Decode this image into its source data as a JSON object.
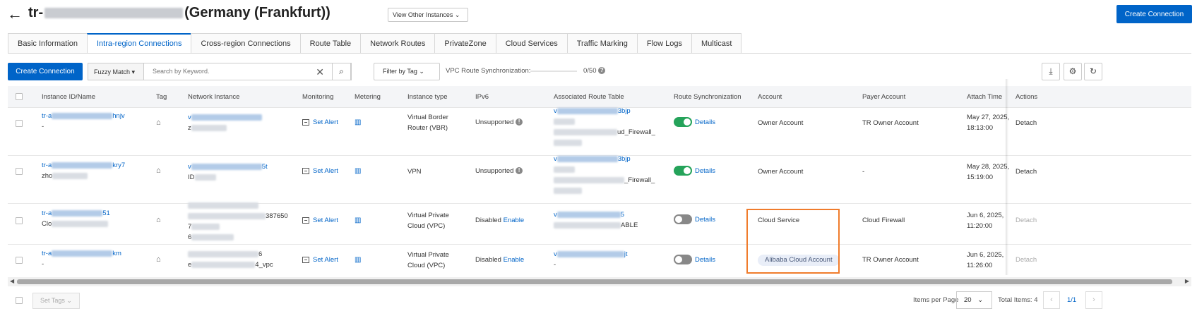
{
  "header": {
    "title_prefix": "tr-",
    "title_suffix": "(Germany (Frankfurt))",
    "view_other": "View Other Instances",
    "create_connection": "Create Connection"
  },
  "tabs": [
    "Basic Information",
    "Intra-region Connections",
    "Cross-region Connections",
    "Route Table",
    "Network Routes",
    "PrivateZone",
    "Cloud Services",
    "Traffic Marking",
    "Flow Logs",
    "Multicast"
  ],
  "active_tab": "Intra-region Connections",
  "toolbar": {
    "create_connection": "Create Connection",
    "fuzzy_match": "Fuzzy Match",
    "search_placeholder": "Search by Keyword.",
    "filter_by_tag": "Filter by Tag",
    "vpc_sync_label": "VPC Route Synchronization:",
    "vpc_sync_count": "0/50"
  },
  "columns": [
    "Instance ID/Name",
    "Tag",
    "Network Instance",
    "Monitoring",
    "Metering",
    "Instance type",
    "IPv6",
    "Associated Route Table",
    "Route Synchronization",
    "Account",
    "Payer Account",
    "Attach Time",
    "Actions"
  ],
  "rows": [
    {
      "id_prefix": "tr-a",
      "id_suffix": "hnjv",
      "name": "-",
      "net_line1": "v",
      "net_line2": "z",
      "set_alert": "Set Alert",
      "type_line1": "Virtual Border",
      "type_line2": "Router (VBR)",
      "ipv6": "Unsupported",
      "ipv6_enable": "",
      "rt_line1_prefix": "v",
      "rt_line1_suffix": "3bjp",
      "rt_line2": "ud_Firewall_",
      "sync_on": true,
      "details": "Details",
      "account": "Owner Account",
      "payer": "TR Owner Account",
      "time_line1": "May 27, 2025,",
      "time_line2": "18:13:00",
      "action": "Detach"
    },
    {
      "id_prefix": "tr-a",
      "id_suffix": "kry7",
      "name": "zho",
      "net_line1_prefix": "v",
      "net_line1_suffix": "5t",
      "net_line2": "ID",
      "set_alert": "Set Alert",
      "type_line1": "VPN",
      "type_line2": "",
      "ipv6": "Unsupported",
      "ipv6_enable": "",
      "rt_line1_prefix": "v",
      "rt_line1_suffix": "3bjp",
      "rt_line2": "_Firewall_",
      "sync_on": true,
      "details": "Details",
      "account": "Owner Account",
      "payer": "-",
      "time_line1": "May 28, 2025,",
      "time_line2": "15:19:00",
      "action": "Detach"
    },
    {
      "id_prefix": "tr-a",
      "id_suffix": "51",
      "name": "Clo",
      "net_line1_suffix": "387650",
      "net_line2": "7",
      "net_line3": "6",
      "set_alert": "Set Alert",
      "type_line1": "Virtual Private",
      "type_line2": "Cloud (VPC)",
      "ipv6": "Disabled",
      "ipv6_enable": "Enable",
      "rt_line1_prefix": "v",
      "rt_line1_suffix": "5",
      "rt_line2": "ABLE",
      "sync_on": false,
      "details": "Details",
      "account": "Cloud Service",
      "payer": "Cloud Firewall",
      "time_line1": "Jun 6, 2025,",
      "time_line2": "11:20:00",
      "action": "Detach"
    },
    {
      "id_prefix": "tr-a",
      "id_suffix": "km",
      "name": "-",
      "net_line1_suffix": "6",
      "net_line2_prefix": "e",
      "net_line2_suffix": "4_vpc",
      "set_alert": "Set Alert",
      "type_line1": "Virtual Private",
      "type_line2": "Cloud (VPC)",
      "ipv6": "Disabled",
      "ipv6_enable": "Enable",
      "rt_line1_prefix": "v",
      "rt_line1_suffix": "jt",
      "rt_line2": "-",
      "sync_on": false,
      "details": "Details",
      "account": "Alibaba Cloud Account",
      "payer": "TR Owner Account",
      "time_line1": "Jun 6, 2025,",
      "time_line2": "11:26:00",
      "action": "Detach"
    }
  ],
  "footer": {
    "set_tags": "Set Tags",
    "items_per_page_label": "Items per Page",
    "items_per_page": "20",
    "total_items": "Total Items: 4",
    "page": "1/1"
  },
  "colors": {
    "primary": "#0064c8",
    "highlight": "#f07c2c",
    "toggle_on": "#25a35a"
  },
  "icons": [
    "back-arrow-icon",
    "chevron-down-icon",
    "close-icon",
    "search-icon",
    "download-icon",
    "gear-icon",
    "refresh-icon",
    "tag-icon",
    "alert-icon",
    "bar-chart-icon",
    "help-icon"
  ]
}
